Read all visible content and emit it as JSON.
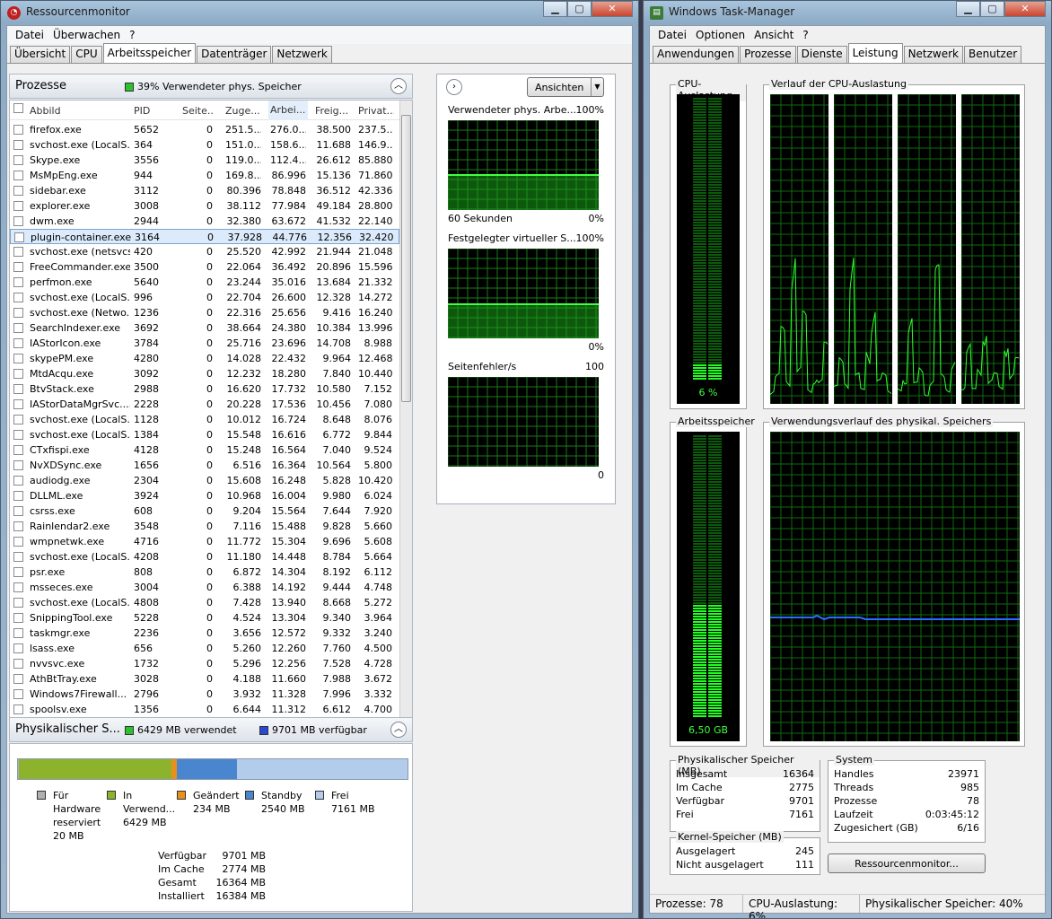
{
  "rm": {
    "title": "Ressourcenmonitor",
    "menu": [
      "Datei",
      "Überwachen",
      "?"
    ],
    "tabs": [
      "Übersicht",
      "CPU",
      "Arbeitsspeicher",
      "Datenträger",
      "Netzwerk"
    ],
    "active_tab": 2,
    "proc_header": {
      "title": "Prozesse",
      "usage": "39% Verwendeter phys. Speicher"
    },
    "columns": [
      "Abbild",
      "PID",
      "Seite...",
      "Zuge...",
      "Arbei...",
      "Freig...",
      "Privat..."
    ],
    "rows": [
      [
        "firefox.exe",
        "5652",
        "0",
        "251.5...",
        "276.0...",
        "38.500",
        "237.5..."
      ],
      [
        "svchost.exe (LocalS...",
        "364",
        "0",
        "151.0...",
        "158.6...",
        "11.688",
        "146.9..."
      ],
      [
        "Skype.exe",
        "3556",
        "0",
        "119.0...",
        "112.4...",
        "26.612",
        "85.880"
      ],
      [
        "MsMpEng.exe",
        "944",
        "0",
        "169.8...",
        "86.996",
        "15.136",
        "71.860"
      ],
      [
        "sidebar.exe",
        "3112",
        "0",
        "80.396",
        "78.848",
        "36.512",
        "42.336"
      ],
      [
        "explorer.exe",
        "3008",
        "0",
        "38.112",
        "77.984",
        "49.184",
        "28.800"
      ],
      [
        "dwm.exe",
        "2944",
        "0",
        "32.380",
        "63.672",
        "41.532",
        "22.140"
      ],
      [
        "plugin-container.exe",
        "3164",
        "0",
        "37.928",
        "44.776",
        "12.356",
        "32.420"
      ],
      [
        "svchost.exe (netsvcs)",
        "420",
        "0",
        "25.520",
        "42.992",
        "21.944",
        "21.048"
      ],
      [
        "FreeCommander.exe",
        "3500",
        "0",
        "22.064",
        "36.492",
        "20.896",
        "15.596"
      ],
      [
        "perfmon.exe",
        "5640",
        "0",
        "23.244",
        "35.016",
        "13.684",
        "21.332"
      ],
      [
        "svchost.exe (LocalS...",
        "996",
        "0",
        "22.704",
        "26.600",
        "12.328",
        "14.272"
      ],
      [
        "svchost.exe (Netwo...",
        "1236",
        "0",
        "22.316",
        "25.656",
        "9.416",
        "16.240"
      ],
      [
        "SearchIndexer.exe",
        "3692",
        "0",
        "38.664",
        "24.380",
        "10.384",
        "13.996"
      ],
      [
        "IAStorIcon.exe",
        "3784",
        "0",
        "25.716",
        "23.696",
        "14.708",
        "8.988"
      ],
      [
        "skypePM.exe",
        "4280",
        "0",
        "14.028",
        "22.432",
        "9.964",
        "12.468"
      ],
      [
        "MtdAcqu.exe",
        "3092",
        "0",
        "12.232",
        "18.280",
        "7.840",
        "10.440"
      ],
      [
        "BtvStack.exe",
        "2988",
        "0",
        "16.620",
        "17.732",
        "10.580",
        "7.152"
      ],
      [
        "IAStorDataMgrSvc....",
        "2228",
        "0",
        "20.228",
        "17.536",
        "10.456",
        "7.080"
      ],
      [
        "svchost.exe (LocalS...",
        "1128",
        "0",
        "10.012",
        "16.724",
        "8.648",
        "8.076"
      ],
      [
        "svchost.exe (LocalS...",
        "1384",
        "0",
        "15.548",
        "16.616",
        "6.772",
        "9.844"
      ],
      [
        "CTxfispi.exe",
        "4128",
        "0",
        "15.248",
        "16.564",
        "7.040",
        "9.524"
      ],
      [
        "NvXDSync.exe",
        "1656",
        "0",
        "6.516",
        "16.364",
        "10.564",
        "5.800"
      ],
      [
        "audiodg.exe",
        "2304",
        "0",
        "15.608",
        "16.248",
        "5.828",
        "10.420"
      ],
      [
        "DLLML.exe",
        "3924",
        "0",
        "10.968",
        "16.004",
        "9.980",
        "6.024"
      ],
      [
        "csrss.exe",
        "608",
        "0",
        "9.204",
        "15.564",
        "7.644",
        "7.920"
      ],
      [
        "Rainlendar2.exe",
        "3548",
        "0",
        "7.116",
        "15.488",
        "9.828",
        "5.660"
      ],
      [
        "wmpnetwk.exe",
        "4716",
        "0",
        "11.772",
        "15.304",
        "9.696",
        "5.608"
      ],
      [
        "svchost.exe (LocalS...",
        "4208",
        "0",
        "11.180",
        "14.448",
        "8.784",
        "5.664"
      ],
      [
        "psr.exe",
        "808",
        "0",
        "6.872",
        "14.304",
        "8.192",
        "6.112"
      ],
      [
        "msseces.exe",
        "3004",
        "0",
        "6.388",
        "14.192",
        "9.444",
        "4.748"
      ],
      [
        "svchost.exe (LocalS...",
        "4808",
        "0",
        "7.428",
        "13.940",
        "8.668",
        "5.272"
      ],
      [
        "SnippingTool.exe",
        "5228",
        "0",
        "4.524",
        "13.304",
        "9.340",
        "3.964"
      ],
      [
        "taskmgr.exe",
        "2236",
        "0",
        "3.656",
        "12.572",
        "9.332",
        "3.240"
      ],
      [
        "lsass.exe",
        "656",
        "0",
        "5.260",
        "12.260",
        "7.760",
        "4.500"
      ],
      [
        "nvvsvc.exe",
        "1732",
        "0",
        "5.296",
        "12.256",
        "7.528",
        "4.728"
      ],
      [
        "AthBtTray.exe",
        "3028",
        "0",
        "4.188",
        "11.660",
        "7.988",
        "3.672"
      ],
      [
        "Windows7Firewall...",
        "2796",
        "0",
        "3.932",
        "11.328",
        "7.996",
        "3.332"
      ],
      [
        "spoolsv.exe",
        "1356",
        "0",
        "6.644",
        "11.312",
        "6.612",
        "4.700"
      ]
    ],
    "selected_row": 7,
    "phys_header": {
      "title": "Physikalischer S...",
      "used": "6429 MB verwendet",
      "avail": "9701 MB verfügbar"
    },
    "mem_bar": {
      "hardware_frac": 0.0012,
      "used_frac": 0.3925,
      "modified_frac": 0.0143,
      "standby_frac": 0.1551,
      "free_frac": 0.4369
    },
    "legend": [
      {
        "label": "Für Hardware reserviert",
        "value": "20 MB",
        "color": "#b0b0b0"
      },
      {
        "label": "In Verwend...",
        "value": "6429 MB",
        "color": "#8db32c"
      },
      {
        "label": "Geändert",
        "value": "234 MB",
        "color": "#e8901c"
      },
      {
        "label": "Standby",
        "value": "2540 MB",
        "color": "#4a86d0"
      },
      {
        "label": "Frei",
        "value": "7161 MB",
        "color": "#b4ccec"
      }
    ],
    "summary": [
      [
        "Verfügbar",
        "9701 MB"
      ],
      [
        "Im Cache",
        "2774 MB"
      ],
      [
        "Gesamt",
        "16364 MB"
      ],
      [
        "Installiert",
        "16384 MB"
      ]
    ],
    "views_button": "Ansichten",
    "graphs": [
      {
        "title": "Verwendeter phys. Arbe...",
        "max": "100%",
        "foot_left": "60 Sekunden",
        "foot_right": "0%",
        "level": 0.39
      },
      {
        "title": "Festgelegter virtueller S...",
        "max": "100%",
        "foot_left": "",
        "foot_right": "0%",
        "level": 0.38
      },
      {
        "title": "Seitenfehler/s",
        "max": "100",
        "foot_left": "",
        "foot_right": "0",
        "level": 0
      }
    ]
  },
  "tm": {
    "title": "Windows Task-Manager",
    "menu": [
      "Datei",
      "Optionen",
      "Ansicht",
      "?"
    ],
    "tabs": [
      "Anwendungen",
      "Prozesse",
      "Dienste",
      "Leistung",
      "Netzwerk",
      "Benutzer"
    ],
    "active_tab": 3,
    "cpu_label": "CPU-Auslastung",
    "cpu_value": "6 %",
    "cpu_level": 0.06,
    "cpu_hist_label": "Verlauf der CPU-Auslastung",
    "mem_label": "Arbeitsspeicher",
    "mem_value": "6,50 GB",
    "mem_level": 0.4,
    "mem_hist_label": "Verwendungsverlauf des physikal. Speichers",
    "phys": {
      "title": "Physikalischer Speicher (MB)",
      "rows": [
        [
          "Insgesamt",
          "16364"
        ],
        [
          "Im Cache",
          "2775"
        ],
        [
          "Verfügbar",
          "9701"
        ],
        [
          "Frei",
          "7161"
        ]
      ]
    },
    "system": {
      "title": "System",
      "rows": [
        [
          "Handles",
          "23971"
        ],
        [
          "Threads",
          "985"
        ],
        [
          "Prozesse",
          "78"
        ],
        [
          "Laufzeit",
          "0:03:45:12"
        ],
        [
          "Zugesichert (GB)",
          "6/16"
        ]
      ]
    },
    "kernel": {
      "title": "Kernel-Speicher (MB)",
      "rows": [
        [
          "Ausgelagert",
          "245"
        ],
        [
          "Nicht ausgelagert",
          "111"
        ]
      ]
    },
    "resmon_button": "Ressourcenmonitor...",
    "status": [
      "Prozesse: 78",
      "CPU-Auslastung: 6%",
      "Physikalischer Speicher: 40%"
    ]
  }
}
